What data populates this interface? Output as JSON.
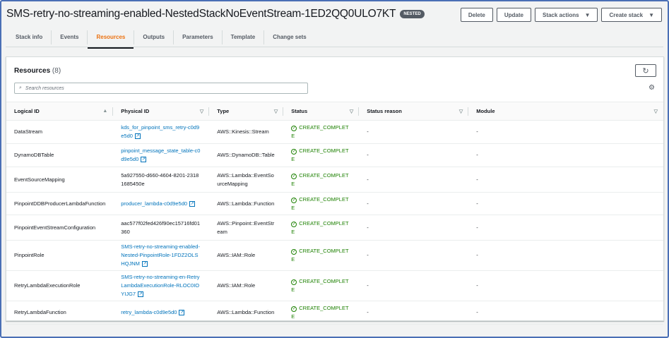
{
  "header": {
    "title": "SMS-retry-no-streaming-enabled-NestedStackNoEventStream-1ED2QQ0ULO7KT",
    "badge": "NESTED",
    "delete": "Delete",
    "update": "Update",
    "stack_actions": "Stack actions",
    "create_stack": "Create stack"
  },
  "tabs": [
    "Stack info",
    "Events",
    "Resources",
    "Outputs",
    "Parameters",
    "Template",
    "Change sets"
  ],
  "panel": {
    "title": "Resources",
    "count": "(8)",
    "search_placeholder": "Search resources"
  },
  "columns": [
    "Logical ID",
    "Physical ID",
    "Type",
    "Status",
    "Status reason",
    "Module"
  ],
  "rows": [
    {
      "logical": "DataStream",
      "physical": "kds_for_pinpoint_sms_retry-c0d9e5d0",
      "link": true,
      "type": "AWS::Kinesis::Stream",
      "status": "CREATE_COMPLETE",
      "reason": "-",
      "module": "-"
    },
    {
      "logical": "DynamoDBTable",
      "physical": "pinpoint_message_state_table-c0d9e5d0",
      "link": true,
      "type": "AWS::DynamoDB::Table",
      "status": "CREATE_COMPLETE",
      "reason": "-",
      "module": "-"
    },
    {
      "logical": "EventSourceMapping",
      "physical": "5a927550-d660-4604-8201-23181685450e",
      "link": false,
      "type": "AWS::Lambda::EventSourceMapping",
      "status": "CREATE_COMPLETE",
      "reason": "-",
      "module": "-"
    },
    {
      "logical": "PinpointDDBProducerLambdaFunction",
      "physical": "producer_lambda-c0d9e5d0",
      "link": true,
      "type": "AWS::Lambda::Function",
      "status": "CREATE_COMPLETE",
      "reason": "-",
      "module": "-"
    },
    {
      "logical": "PinpointEventStreamConfiguration",
      "physical": "aac577f02fed426f90ec15716fd01360",
      "link": false,
      "type": "AWS::Pinpoint::EventStream",
      "status": "CREATE_COMPLETE",
      "reason": "-",
      "module": "-"
    },
    {
      "logical": "PinpointRole",
      "physical": "SMS-retry-no-streaming-enabled-Nested-PinpointRole-1FDZ2OLSHQJNM",
      "link": true,
      "type": "AWS::IAM::Role",
      "status": "CREATE_COMPLETE",
      "reason": "-",
      "module": "-"
    },
    {
      "logical": "RetryLambdaExecutionRole",
      "physical": "SMS-retry-no-streaming-en-RetryLambdaExecutionRole-RLOC0IOYIJG7",
      "link": true,
      "type": "AWS::IAM::Role",
      "status": "CREATE_COMPLETE",
      "reason": "-",
      "module": "-"
    },
    {
      "logical": "RetryLambdaFunction",
      "physical": "retry_lambda-c0d9e5d0",
      "link": true,
      "type": "AWS::Lambda::Function",
      "status": "CREATE_COMPLETE",
      "reason": "-",
      "module": "-"
    }
  ]
}
